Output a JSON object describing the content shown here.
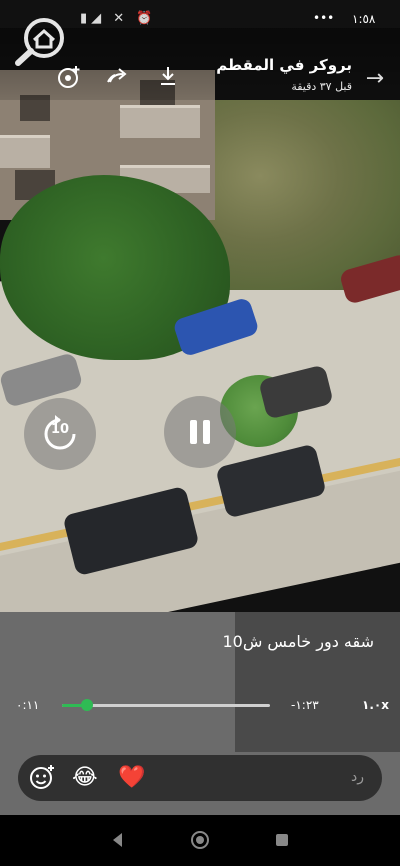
{
  "status_bar": {
    "time": "١:٥٨"
  },
  "header": {
    "title": "بروكر في المقطم",
    "subtitle": "قبل ٣٧ دقيقة"
  },
  "video": {
    "caption": "شقه دور خامس ش10",
    "elapsed": "٠:١١",
    "remaining": "-١:٢٣",
    "speed": "١.٠x",
    "progress_fraction": 0.12,
    "rewind_seconds": "10"
  },
  "reply": {
    "placeholder": "رد",
    "quick_reactions": [
      "😂",
      "❤️"
    ]
  },
  "icons": {
    "add_status": "add-emoji-icon",
    "pause": "pause-icon",
    "rewind": "rewind-10-icon",
    "share": "share-icon",
    "forward": "forward-icon",
    "download": "download-icon",
    "sticker": "sticker-icon"
  },
  "colors": {
    "accent": "#2fbb54"
  }
}
